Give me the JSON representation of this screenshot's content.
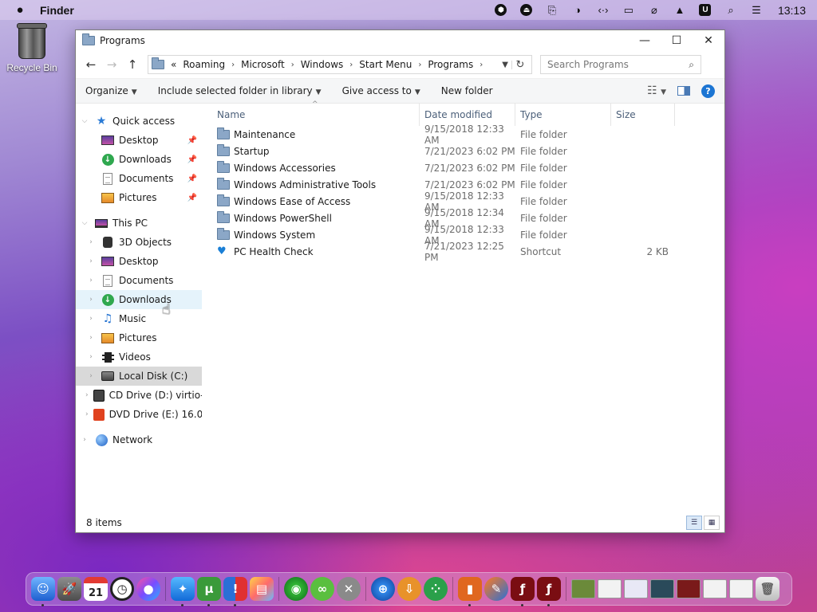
{
  "menubar": {
    "app_name": "Finder",
    "clock": "13:13",
    "status_icons": [
      "app-icon",
      "eject-circle-icon",
      "clipboard-icon",
      "contrast-icon",
      "code-icon",
      "display-icon",
      "muted-icon",
      "arrow-up-icon",
      "u-icon",
      "search-icon",
      "control-center-icon"
    ]
  },
  "desktop": {
    "recycle_bin_label": "Recycle Bin"
  },
  "window": {
    "title": "Programs",
    "controls": {
      "minimize": "—",
      "maximize": "☐",
      "close": "✕"
    },
    "address": {
      "overflow": "«",
      "crumbs": [
        "Roaming",
        "Microsoft",
        "Windows",
        "Start Menu",
        "Programs"
      ]
    },
    "search_placeholder": "Search Programs",
    "commands": {
      "organize": "Organize",
      "include": "Include selected folder in library",
      "give_access": "Give access to",
      "new_folder": "New folder"
    },
    "nav": {
      "quick_access": "Quick access",
      "qa_items": [
        "Desktop",
        "Downloads",
        "Documents",
        "Pictures"
      ],
      "this_pc": "This PC",
      "pc_items": [
        "3D Objects",
        "Desktop",
        "Documents",
        "Downloads",
        "Music",
        "Pictures",
        "Videos",
        "Local Disk (C:)",
        "CD Drive (D:) virtio-",
        "DVD Drive (E:) 16.0."
      ],
      "network": "Network"
    },
    "columns": {
      "name": "Name",
      "date": "Date modified",
      "type": "Type",
      "size": "Size"
    },
    "files": [
      {
        "name": "Maintenance",
        "date": "9/15/2018 12:33 AM",
        "type": "File folder",
        "size": ""
      },
      {
        "name": "Startup",
        "date": "7/21/2023 6:02 PM",
        "type": "File folder",
        "size": ""
      },
      {
        "name": "Windows Accessories",
        "date": "7/21/2023 6:02 PM",
        "type": "File folder",
        "size": ""
      },
      {
        "name": "Windows Administrative Tools",
        "date": "7/21/2023 6:02 PM",
        "type": "File folder",
        "size": ""
      },
      {
        "name": "Windows Ease of Access",
        "date": "9/15/2018 12:33 AM",
        "type": "File folder",
        "size": ""
      },
      {
        "name": "Windows PowerShell",
        "date": "9/15/2018 12:34 AM",
        "type": "File folder",
        "size": ""
      },
      {
        "name": "Windows System",
        "date": "9/15/2018 12:33 AM",
        "type": "File folder",
        "size": ""
      },
      {
        "name": "PC Health Check",
        "date": "7/21/2023 12:25 PM",
        "type": "Shortcut",
        "size": "2 KB"
      }
    ],
    "status": "8 items"
  },
  "dock": {
    "calendar_day": "21"
  }
}
